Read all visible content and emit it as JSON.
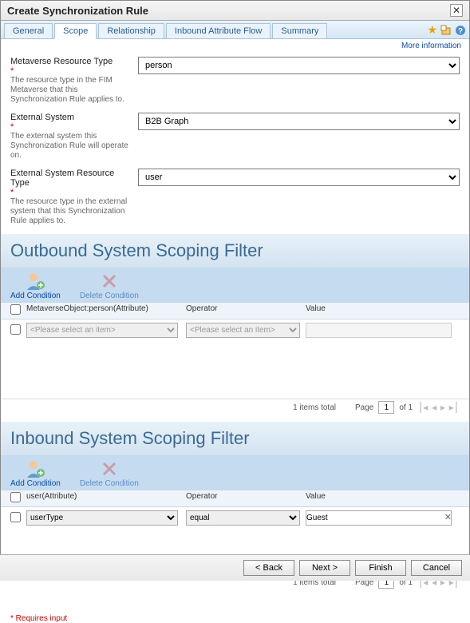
{
  "window": {
    "title": "Create Synchronization Rule"
  },
  "tabs": [
    "General",
    "Scope",
    "Relationship",
    "Inbound Attribute Flow",
    "Summary"
  ],
  "active_tab": 1,
  "more_info": "More information",
  "fields": {
    "mv_type": {
      "label": "Metaverse Resource Type",
      "desc": "The resource type in the FIM Metaverse that this Synchronization Rule applies to.",
      "value": "person"
    },
    "ext_sys": {
      "label": "External System",
      "desc": "The external system this Synchronization Rule will operate on.",
      "value": "B2B Graph"
    },
    "ext_type": {
      "label": "External System Resource Type",
      "desc": "The resource type in the external system that this Synchronization Rule applies to.",
      "value": "user"
    }
  },
  "outbound": {
    "title": "Outbound System Scoping Filter",
    "add_label": "Add Condition",
    "del_label": "Delete Condition",
    "columns": {
      "attr": "MetaverseObject:person(Attribute)",
      "op": "Operator",
      "val": "Value"
    },
    "row": {
      "attr_placeholder": "<Please select an item>",
      "op_placeholder": "<Please select an item>",
      "val": ""
    },
    "pager": {
      "total": "1 items total",
      "page_lbl": "Page",
      "page": "1",
      "of": "of 1"
    }
  },
  "inbound": {
    "title": "Inbound System Scoping Filter",
    "add_label": "Add Condition",
    "del_label": "Delete Condition",
    "columns": {
      "attr": "user(Attribute)",
      "op": "Operator",
      "val": "Value"
    },
    "row": {
      "attr": "userType",
      "op": "equal",
      "val": "Guest"
    },
    "pager": {
      "total": "1 items total",
      "page_lbl": "Page",
      "page": "1",
      "of": "of 1"
    }
  },
  "requires_note": "* Requires input",
  "footer": {
    "back": "< Back",
    "next": "Next >",
    "finish": "Finish",
    "cancel": "Cancel"
  }
}
